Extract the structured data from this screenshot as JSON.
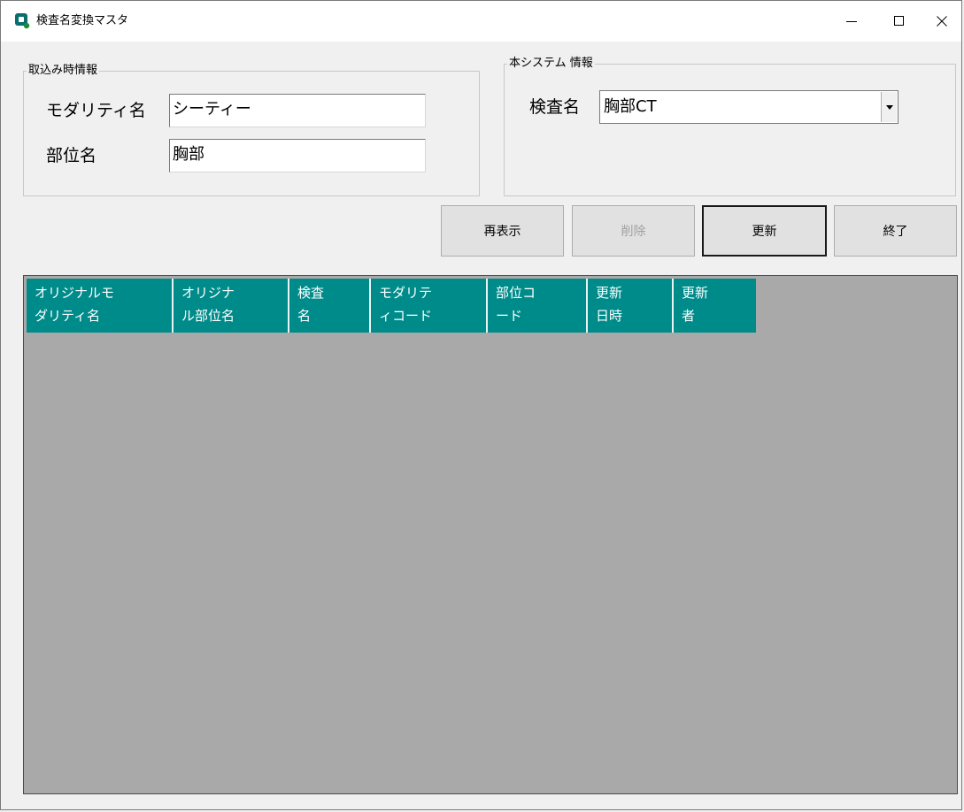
{
  "window": {
    "title": "検査名変換マスタ",
    "minimize_glyph": "—",
    "maximize_glyph": "☐",
    "close_glyph": "✕"
  },
  "import_info": {
    "group_title": "取込み時情報",
    "modality_label": "モダリティ名",
    "modality_value": "シーティー",
    "body_part_label": "部位名",
    "body_part_value": "胸部"
  },
  "system_info": {
    "group_title": "本システム 情報",
    "exam_label": "検査名",
    "exam_value": "胸部CT"
  },
  "buttons": {
    "refresh": "再表示",
    "delete": "削除",
    "update": "更新",
    "exit": "終了"
  },
  "grid": {
    "columns": [
      {
        "label": "オリジナルモ\n  ダリティ名"
      },
      {
        "label": "オリジナ\nル部位名"
      },
      {
        "label": "検査\n 名"
      },
      {
        "label": "モダリテ\nィコード"
      },
      {
        "label": "部位コ\n ード"
      },
      {
        "label": "更新\n日時"
      },
      {
        "label": "更新\n 者"
      }
    ],
    "rows": []
  },
  "colors": {
    "header_bg": "#008b8b",
    "grid_bg": "#a9a9a9",
    "window_bg": "#f0f0f0"
  }
}
